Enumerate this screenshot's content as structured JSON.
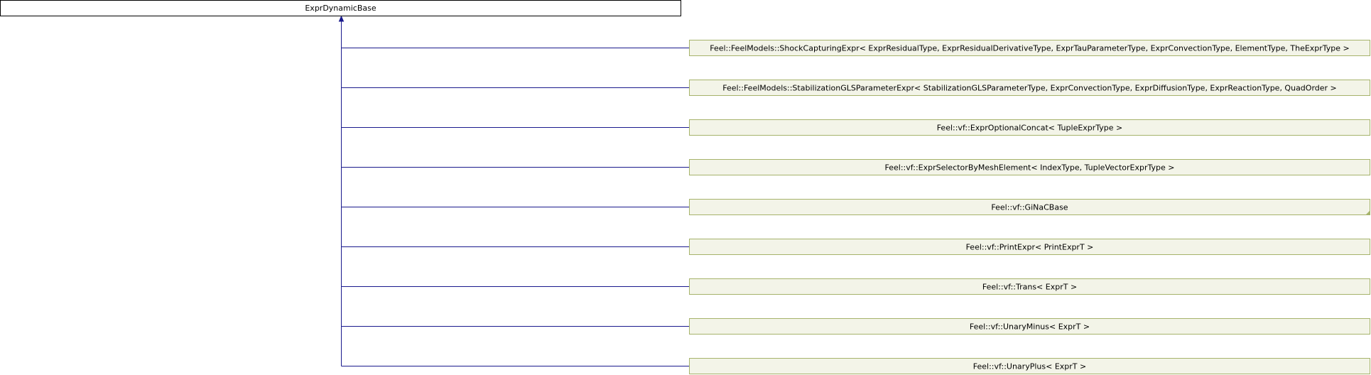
{
  "diagram": {
    "base_class": {
      "label": "ExprDynamicBase"
    },
    "derived_classes": [
      {
        "label": "Feel::FeelModels::ShockCapturingExpr< ExprResidualType, ExprResidualDerivativeType, ExprTauParameterType, ExprConvectionType, ElementType, TheExprType >",
        "folded_corner": false
      },
      {
        "label": "Feel::FeelModels::StabilizationGLSParameterExpr< StabilizationGLSParameterType, ExprConvectionType, ExprDiffusionType, ExprReactionType, QuadOrder >",
        "folded_corner": false
      },
      {
        "label": "Feel::vf::ExprOptionalConcat< TupleExprType >",
        "folded_corner": false
      },
      {
        "label": "Feel::vf::ExprSelectorByMeshElement< IndexType, TupleVectorExprType >",
        "folded_corner": false
      },
      {
        "label": "Feel::vf::GiNaCBase",
        "folded_corner": true
      },
      {
        "label": "Feel::vf::PrintExpr< PrintExprT >",
        "folded_corner": false
      },
      {
        "label": "Feel::vf::Trans< ExprT >",
        "folded_corner": false
      },
      {
        "label": "Feel::vf::UnaryMinus< ExprT >",
        "folded_corner": false
      },
      {
        "label": "Feel::vf::UnaryPlus< ExprT >",
        "folded_corner": false
      }
    ],
    "colors": {
      "base_fill": "#ffffff",
      "base_border": "#000000",
      "derived_fill": "#f3f4e8",
      "derived_border": "#a6b36b",
      "edge": "#19198c",
      "corner": "#a6b36b"
    }
  }
}
